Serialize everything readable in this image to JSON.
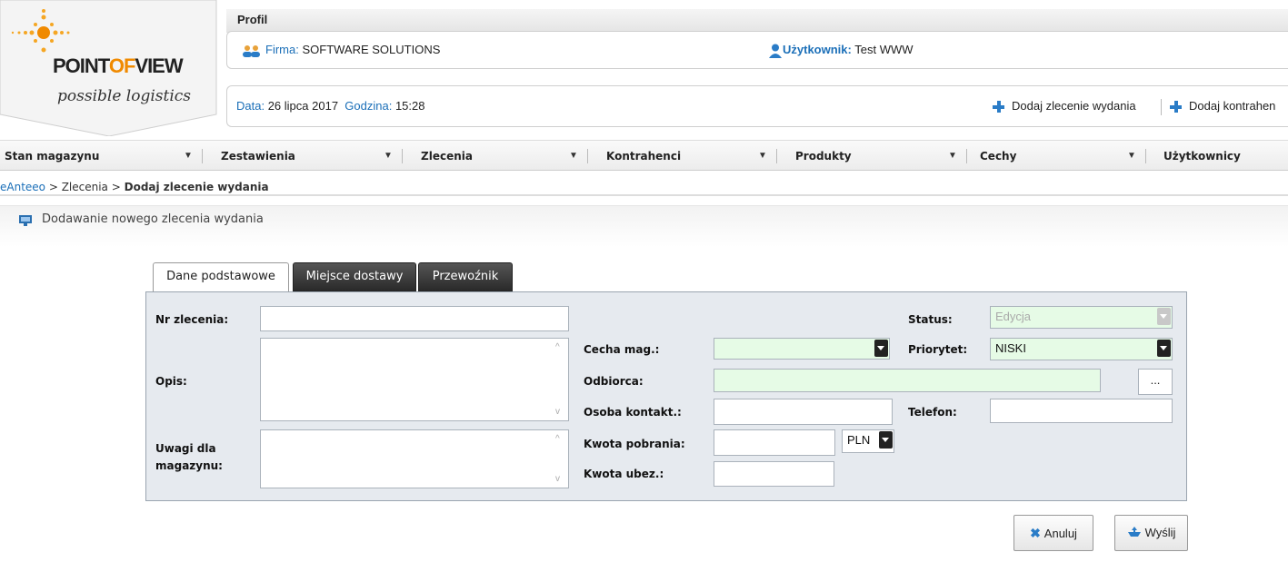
{
  "logo": {
    "brand_left": "POINT",
    "brand_mid": "OF",
    "brand_right": "VIEW",
    "tagline": "possible logistics"
  },
  "profile": {
    "tab_title": "Profil",
    "company_label": "Firma:",
    "company_value": "SOFTWARE SOLUTIONS",
    "user_label": "Użytkownik:",
    "user_value": "Test WWW",
    "date_label": "Data:",
    "date_value": "26 lipca 2017",
    "time_label": "Godzina:",
    "time_value": "15:28",
    "action_add_order": "Dodaj zlecenie wydania",
    "action_add_contractor": "Dodaj kontrahen"
  },
  "menu": {
    "items": [
      {
        "label": "Stan magazynu"
      },
      {
        "label": "Zestawienia"
      },
      {
        "label": "Zlecenia"
      },
      {
        "label": "Kontrahenci"
      },
      {
        "label": "Produkty"
      },
      {
        "label": "Cechy"
      },
      {
        "label": "Użytkownicy"
      }
    ]
  },
  "breadcrumb": {
    "root": "eAnteeo",
    "sep1": " > ",
    "level1": "Zlecenia",
    "sep2": " > ",
    "current": "Dodaj zlecenie wydania"
  },
  "page_title": "Dodawanie nowego zlecenia wydania",
  "tabs": [
    {
      "label": "Dane podstawowe",
      "active": true
    },
    {
      "label": "Miejsce dostawy",
      "active": false
    },
    {
      "label": "Przewoźnik",
      "active": false
    }
  ],
  "form": {
    "order_no_label": "Nr zlecenia:",
    "order_no_value": "",
    "description_label": "Opis:",
    "description_value": "",
    "notes_label_line1": "Uwagi dla",
    "notes_label_line2": "magazynu:",
    "notes_value": "",
    "feature_label": "Cecha mag.:",
    "feature_value": "",
    "recipient_label": "Odbiorca:",
    "recipient_value": "",
    "recipient_browse": "...",
    "contact_label": "Osoba kontakt.:",
    "contact_value": "",
    "cod_label": "Kwota pobrania:",
    "cod_value": "",
    "currency_value": "PLN",
    "insurance_label": "Kwota ubez.:",
    "insurance_value": "",
    "status_label": "Status:",
    "status_value": "Edycja",
    "priority_label": "Priorytet:",
    "priority_value": "NISKI",
    "phone_label": "Telefon:",
    "phone_value": ""
  },
  "buttons": {
    "cancel": "Anuluj",
    "send": "Wyślij"
  },
  "colors": {
    "accent_blue": "#1b6fb8",
    "logo_orange": "#f08a00",
    "form_bg": "#e6eaef",
    "field_green": "#e6fbe6"
  }
}
